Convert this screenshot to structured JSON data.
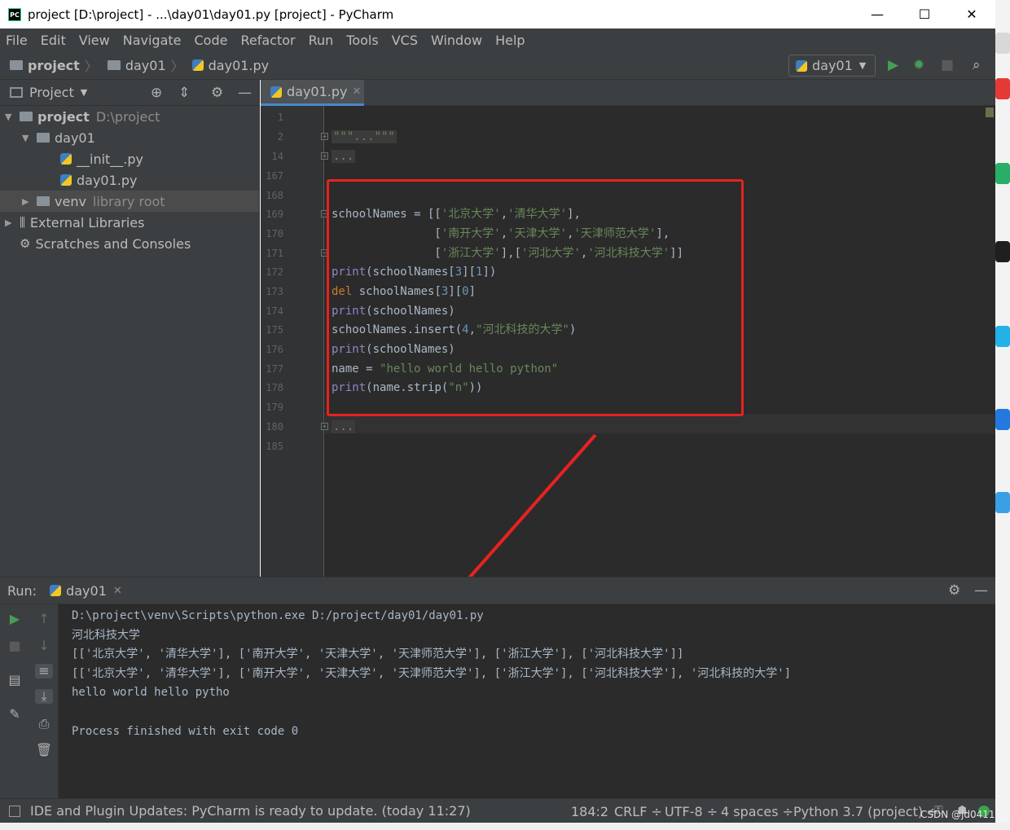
{
  "window": {
    "title": "project [D:\\project] - ...\\day01\\day01.py [project] - PyCharm",
    "app_icon_label": "PC",
    "controls": [
      "—",
      "☐",
      "✕"
    ]
  },
  "menu": [
    "File",
    "Edit",
    "View",
    "Navigate",
    "Code",
    "Refactor",
    "Run",
    "Tools",
    "VCS",
    "Window",
    "Help"
  ],
  "navbar": {
    "crumbs": [
      "project",
      "day01",
      "day01.py"
    ],
    "run_config": "day01"
  },
  "project_panel": {
    "title": "Project",
    "tree": {
      "root_name": "project",
      "root_path": "D:\\project",
      "day01": "day01",
      "init_file": "__init__.py",
      "main_file": "day01.py",
      "venv": "venv",
      "venv_note": "library root",
      "external": "External Libraries",
      "scratches": "Scratches and Consoles"
    }
  },
  "editor": {
    "tab": "day01.py",
    "lines": [
      {
        "n": "1",
        "code": ""
      },
      {
        "n": "2",
        "code": "\"\"\"...\"\"\""
      },
      {
        "n": "14",
        "code": "..."
      },
      {
        "n": "167",
        "code": ""
      },
      {
        "n": "168",
        "code": ""
      },
      {
        "n": "169",
        "code": "schoolNames = [['北京大学','清华大学'],"
      },
      {
        "n": "170",
        "code": "               ['南开大学','天津大学','天津师范大学'],"
      },
      {
        "n": "171",
        "code": "               ['浙江大学'],['河北大学','河北科技大学']]"
      },
      {
        "n": "172",
        "code": "print(schoolNames[3][1])"
      },
      {
        "n": "173",
        "code": "del schoolNames[3][0]"
      },
      {
        "n": "174",
        "code": "print(schoolNames)"
      },
      {
        "n": "175",
        "code": "schoolNames.insert(4,\"河北科技的大学\")"
      },
      {
        "n": "176",
        "code": "print(schoolNames)"
      },
      {
        "n": "177",
        "code": "name = \"hello world hello python\""
      },
      {
        "n": "178",
        "code": "print(name.strip(\"n\"))"
      },
      {
        "n": "179",
        "code": ""
      },
      {
        "n": "180",
        "code": "..."
      },
      {
        "n": "185",
        "code": ""
      }
    ]
  },
  "run_panel": {
    "label": "Run:",
    "tab": "day01",
    "output": [
      "D:\\project\\venv\\Scripts\\python.exe D:/project/day01/day01.py",
      "河北科技大学",
      "[['北京大学', '清华大学'], ['南开大学', '天津大学', '天津师范大学'], ['浙江大学'], ['河北科技大学']]",
      "[['北京大学', '清华大学'], ['南开大学', '天津大学', '天津师范大学'], ['浙江大学'], ['河北科技大学'], '河北科技的大学']",
      "hello world hello pytho",
      "",
      "Process finished with exit code 0"
    ]
  },
  "statusbar": {
    "message": "IDE and Plugin Updates: PyCharm is ready to update. (today 11:27)",
    "position": "184:2",
    "line_sep": "CRLF ÷",
    "encoding": "UTF-8 ÷",
    "indent": "4 spaces ÷",
    "interpreter": "Python 3.7 (project) ÷"
  },
  "watermark": "CSDN @jd0411",
  "colors": {
    "annotation": "#e8221f",
    "run_green": "#499c54",
    "keyword": "#cc7832",
    "string": "#6a8759",
    "number": "#6897bb",
    "builtin": "#8888c6"
  }
}
